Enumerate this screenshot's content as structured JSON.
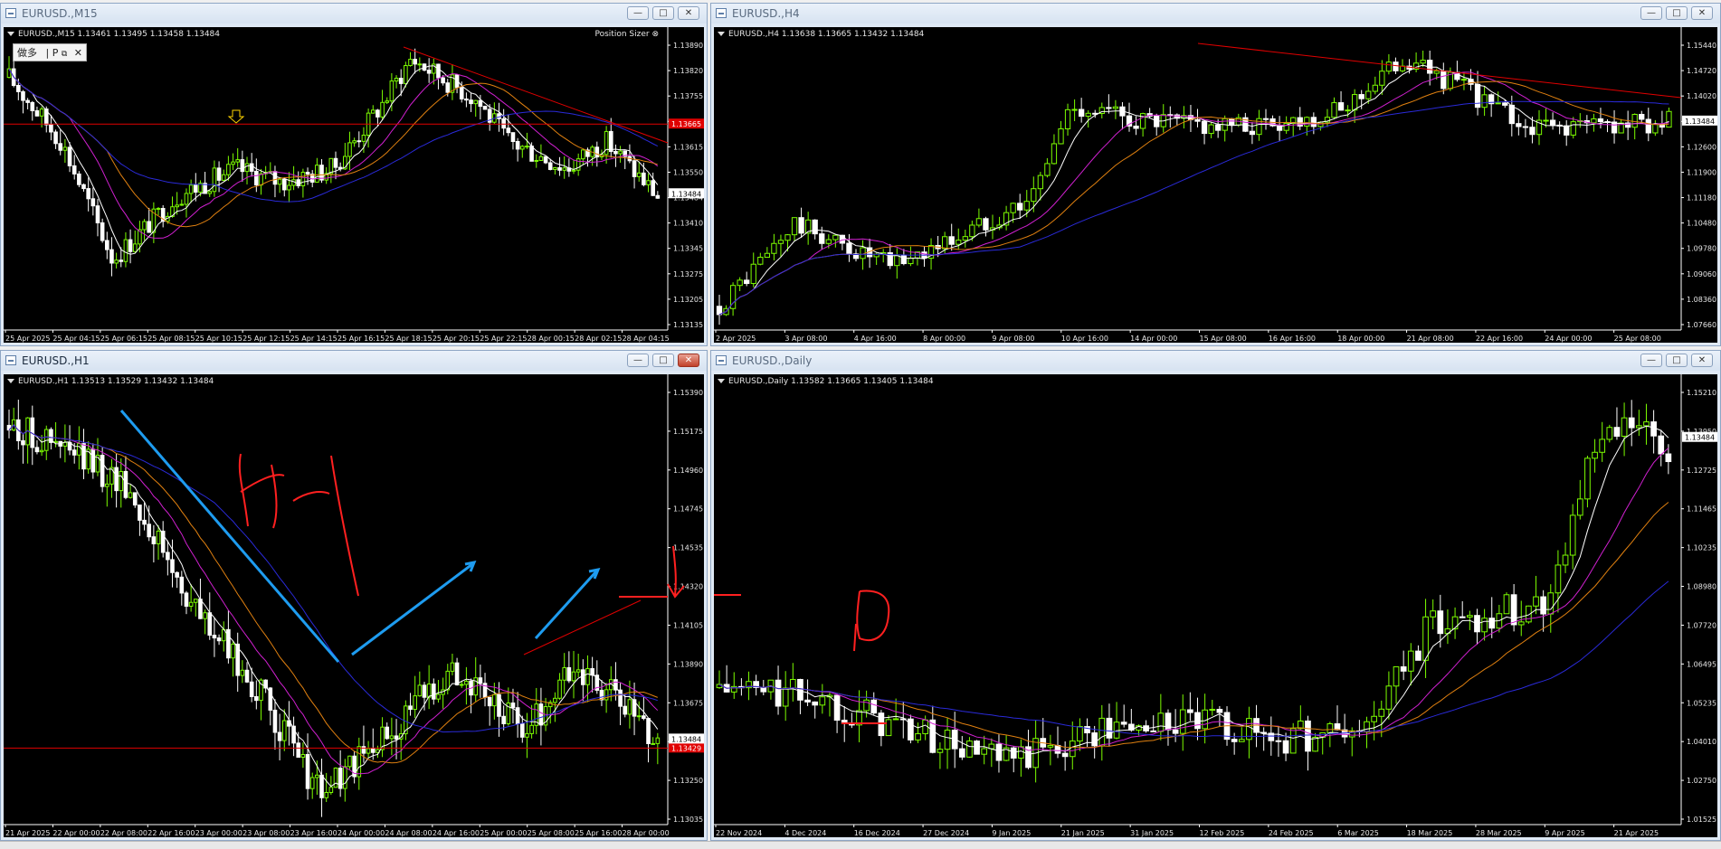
{
  "colors": {
    "bull": "#7cfc00",
    "bear": "#ffffff",
    "ma_white": "#ffffff",
    "ma_magenta": "#d020d0",
    "ma_orange": "#e08010",
    "ma_blue": "#2a2ad8",
    "hline": "#e00000",
    "trend": "#e00000",
    "annot_blue": "#1e9cf0",
    "annot_red": "#ff2020"
  },
  "windows": [
    {
      "id": "m15",
      "title": "EURUSD.,M15",
      "ohlc": "EURUSD.,M15  1.13461 1.13495 1.13458 1.13484",
      "price_levels": [
        "1.13890",
        "1.13820",
        "1.13755",
        "1.13685",
        "1.13615",
        "1.13550",
        "1.13484",
        "1.13410",
        "1.13345",
        "1.13275",
        "1.13205",
        "1.13135"
      ],
      "time_labels": [
        "25 Apr 2025",
        "25 Apr 04:15",
        "25 Apr 06:15",
        "25 Apr 08:15",
        "25 Apr 10:15",
        "25 Apr 12:15",
        "25 Apr 14:15",
        "25 Apr 16:15",
        "25 Apr 18:15",
        "25 Apr 20:15",
        "25 Apr 22:15",
        "28 Apr 00:15",
        "28 Apr 02:15",
        "28 Apr 04:15"
      ],
      "price_tag": "1.13484",
      "red_tag": "1.13665",
      "position_sizer": "Position Sizer",
      "panel_label": "做多",
      "panel_p": "P"
    },
    {
      "id": "h4",
      "title": "EURUSD.,H4",
      "ohlc": "EURUSD.,H4  1.13638 1.13665 1.13432 1.13484",
      "price_levels": [
        "1.15440",
        "1.14720",
        "1.14020",
        "1.13320",
        "1.12600",
        "1.11900",
        "1.11180",
        "1.10480",
        "1.09780",
        "1.09060",
        "1.08360",
        "1.07660"
      ],
      "time_labels": [
        "2 Apr 2025",
        "3 Apr 08:00",
        "4 Apr 16:00",
        "8 Apr 00:00",
        "9 Apr 08:00",
        "10 Apr 16:00",
        "14 Apr 00:00",
        "15 Apr 08:00",
        "16 Apr 16:00",
        "18 Apr 00:00",
        "21 Apr 08:00",
        "22 Apr 16:00",
        "24 Apr 00:00",
        "25 Apr 08:00"
      ],
      "price_tag": "1.13484"
    },
    {
      "id": "h1",
      "title": "EURUSD.,H1",
      "ohlc": "EURUSD.,H1  1.13513 1.13529 1.13432 1.13484",
      "price_levels": [
        "1.15390",
        "1.15175",
        "1.14960",
        "1.14745",
        "1.14535",
        "1.14320",
        "1.14105",
        "1.13890",
        "1.13675",
        "1.13484",
        "1.13250",
        "1.13035"
      ],
      "time_labels": [
        "21 Apr 2025",
        "22 Apr 00:00",
        "22 Apr 08:00",
        "22 Apr 16:00",
        "23 Apr 00:00",
        "23 Apr 08:00",
        "23 Apr 16:00",
        "24 Apr 00:00",
        "24 Apr 08:00",
        "24 Apr 16:00",
        "25 Apr 00:00",
        "25 Apr 08:00",
        "25 Apr 16:00",
        "28 Apr 00:00"
      ],
      "price_tag": "1.13484",
      "red_tag": "1.13429"
    },
    {
      "id": "d1",
      "title": "EURUSD.,Daily",
      "ohlc": "EURUSD.,Daily  1.13582 1.13665 1.13405 1.13484",
      "price_levels": [
        "1.15210",
        "1.13950",
        "1.12725",
        "1.11465",
        "1.10235",
        "1.08980",
        "1.07720",
        "1.06495",
        "1.05235",
        "1.04010",
        "1.02750",
        "1.01525"
      ],
      "time_labels": [
        "22 Nov 2024",
        "4 Dec 2024",
        "16 Dec 2024",
        "27 Dec 2024",
        "9 Jan 2025",
        "21 Jan 2025",
        "31 Jan 2025",
        "12 Feb 2025",
        "24 Feb 2025",
        "6 Mar 2025",
        "18 Mar 2025",
        "28 Mar 2025",
        "9 Apr 2025",
        "21 Apr 2025"
      ],
      "price_tag": "1.13484"
    }
  ]
}
